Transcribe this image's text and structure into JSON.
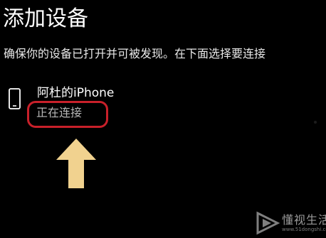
{
  "dialog": {
    "title": "添加设备",
    "description": "确保你的设备已打开并可被发现。在下面选择要连接"
  },
  "device": {
    "name": "阿杜的iPhone",
    "status": "正在连接",
    "icon": "phone-icon"
  },
  "annotation": {
    "highlight_color": "#c8202a",
    "arrow_color": "#f1d28f",
    "arrow_icon": "up-arrow"
  },
  "watermark": {
    "text": "懂视生活",
    "sub": "www.51dongshi.com",
    "logo": "play-triangle-logo"
  }
}
